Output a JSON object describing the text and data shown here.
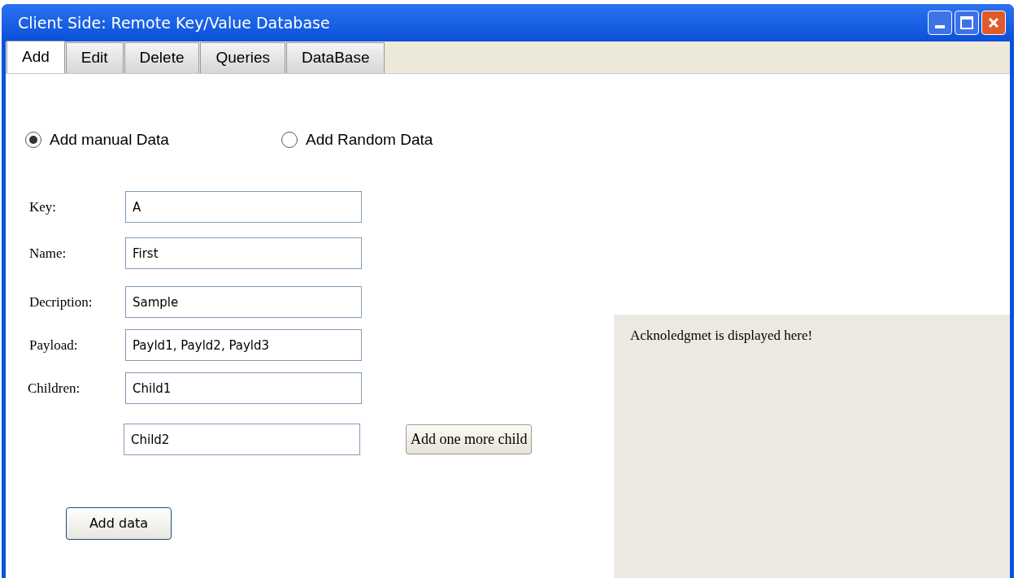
{
  "window": {
    "title": "Client Side: Remote Key/Value Database"
  },
  "tabs": [
    {
      "label": "Add",
      "selected": true
    },
    {
      "label": "Edit",
      "selected": false
    },
    {
      "label": "Delete",
      "selected": false
    },
    {
      "label": "Queries",
      "selected": false
    },
    {
      "label": "DataBase",
      "selected": false
    }
  ],
  "mode_options": [
    {
      "label": "Add manual Data",
      "selected": true
    },
    {
      "label": "Add Random Data",
      "selected": false
    }
  ],
  "fields": [
    {
      "label": "Key:",
      "value": "A"
    },
    {
      "label": "Name:",
      "value": "First"
    },
    {
      "label": "Decription:",
      "value": "Sample"
    },
    {
      "label": "Payload:",
      "value": "Payld1, Payld2, Payld3"
    }
  ],
  "children": {
    "label": "Children:",
    "values": [
      "Child1",
      "Child2"
    ],
    "add_button": "Add one more child"
  },
  "add_button": "Add data",
  "acknowledgement": "Acknoledgmet is displayed here!"
}
